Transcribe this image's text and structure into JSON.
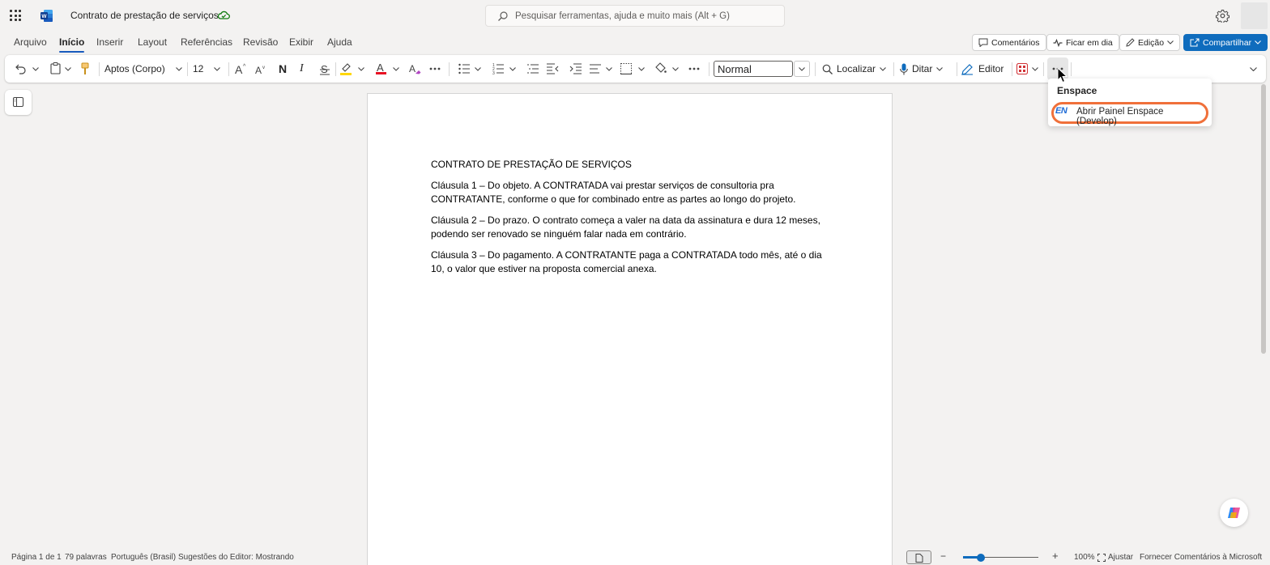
{
  "titlebar": {
    "doc_title": "Contrato de prestação de serviços",
    "search_placeholder": "Pesquisar ferramentas, ajuda e muito mais (Alt + G)"
  },
  "menu_tabs": [
    "Arquivo",
    "Início",
    "Inserir",
    "Layout",
    "Referências",
    "Revisão",
    "Exibir",
    "Ajuda"
  ],
  "menu_right": {
    "comments": "Comentários",
    "catchup": "Ficar em dia",
    "editing": "Edição",
    "share": "Compartilhar"
  },
  "ribbon": {
    "font_name": "Aptos (Corpo)",
    "font_size": "12",
    "bold_glyph": "N",
    "italic_glyph": "I",
    "style": "Normal",
    "find": "Localizar",
    "dictate": "Ditar",
    "editor": "Editor"
  },
  "document": {
    "paragraphs": [
      "CONTRATO DE PRESTAÇÃO DE SERVIÇOS",
      "Cláusula 1 – Do objeto. A CONTRATADA vai prestar serviços de consultoria pra CONTRATANTE, conforme o que for combinado entre as partes ao longo do projeto.",
      "Cláusula 2 – Do prazo. O contrato começa a valer na data da assinatura e dura 12 meses, podendo ser renovado se ninguém falar nada em contrário.",
      "Cláusula 3 – Do pagamento. A CONTRATANTE paga a CONTRATADA todo mês, até o dia 10, o valor que estiver na proposta comercial anexa."
    ]
  },
  "dropdown": {
    "header": "Enspace",
    "item_logo": "EN",
    "item_label": "Abrir Painel Enspace (Develop)"
  },
  "status": {
    "page": "Página 1 de 1",
    "words": "79 palavras",
    "language": "Português (Brasil)",
    "suggestions": "Sugestões do Editor: Mostrando",
    "zoom": "100%",
    "fit": "Ajustar",
    "feedback": "Fornecer Comentários à Microsoft"
  },
  "colors": {
    "accent": "#0f6cbd",
    "highlight_ring": "#f0703a",
    "font_color_swatch": "#e81123",
    "highlighter_swatch": "#ffd700"
  },
  "icons": [
    "waffle-icon",
    "word-logo-icon",
    "cloud-saved-icon",
    "search-icon",
    "gear-icon",
    "comment-icon",
    "catchup-icon",
    "pencil-icon",
    "share-icon",
    "undo-icon",
    "paste-icon",
    "format-painter-icon",
    "mic-icon",
    "editor-pen-icon",
    "more-icon",
    "copilot-icon"
  ]
}
